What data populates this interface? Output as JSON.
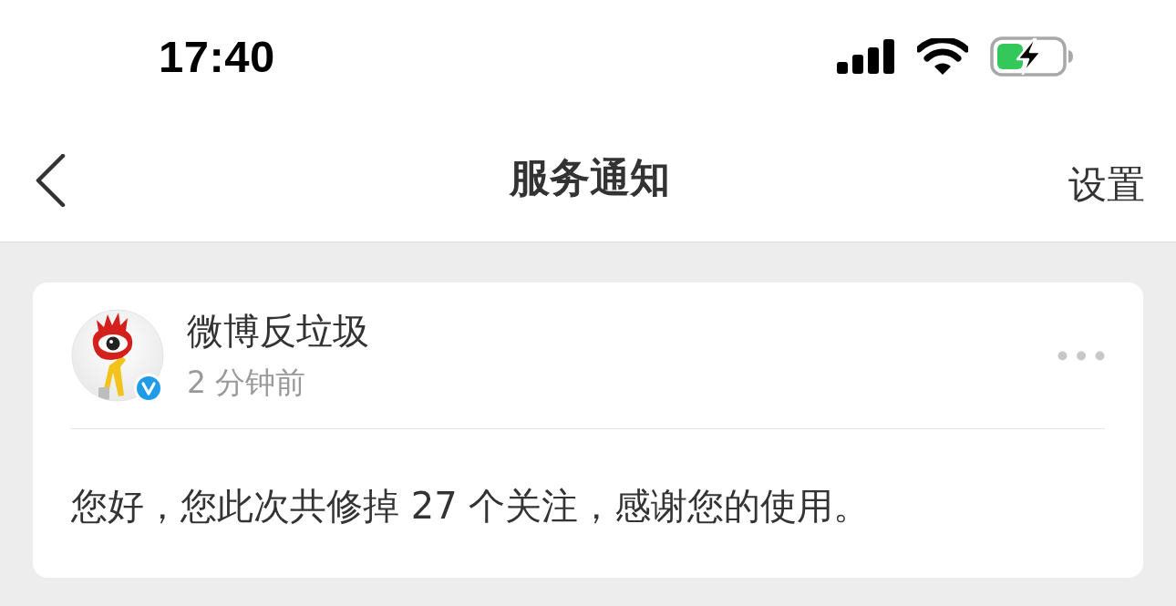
{
  "status_bar": {
    "time": "17:40"
  },
  "nav_bar": {
    "title": "服务通知",
    "action": "设置"
  },
  "notifications": [
    {
      "sender": "微博反垃圾",
      "verified": true,
      "time": "2 分钟前",
      "message": "您好，您此次共修掉 27 个关注，感谢您的使用。"
    }
  ]
}
